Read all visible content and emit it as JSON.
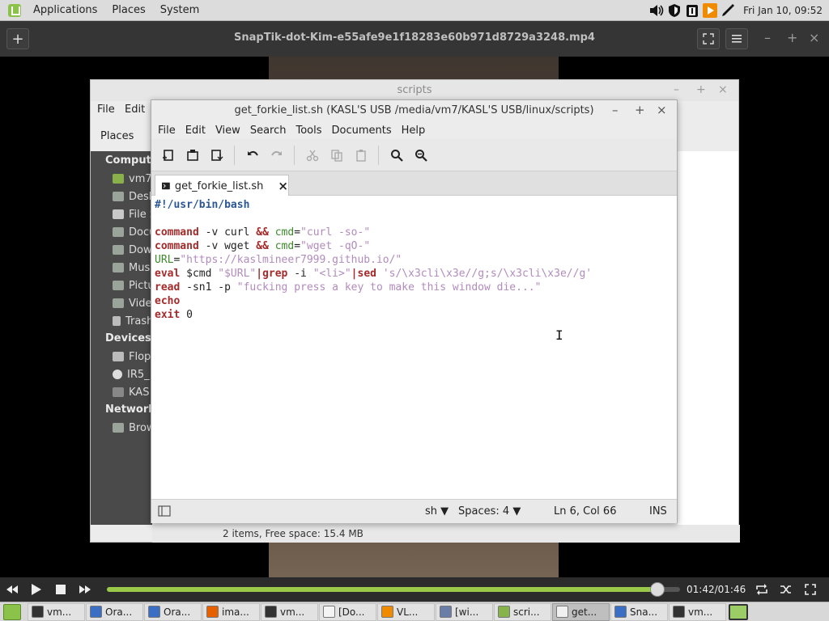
{
  "top_panel": {
    "menus": [
      "Applications",
      "Places",
      "System"
    ],
    "clock": "Fri Jan 10, 09:52"
  },
  "player": {
    "title": "SnapTik-dot-Kim-e55afe9e1f18283e60b971d8729a3248.mp4",
    "time": "01:42/01:46",
    "progress": 0.96,
    "accent_color": "#9ac94a"
  },
  "file_manager": {
    "title": "scripts",
    "menus": [
      "File",
      "Edit"
    ],
    "places_label": "Places",
    "computer_head": "Compute",
    "computer_items": [
      "vm7",
      "Desk",
      "File S",
      "Docu",
      "Dow",
      "Mus",
      "Pictu",
      "Vide",
      "Trash"
    ],
    "devices_head": "Devices",
    "device_items": [
      "Flop",
      "IR5_",
      "KAS"
    ],
    "network_head": "Network",
    "network_items": [
      "Brow"
    ],
    "status": "2 items, Free space: 15.4 MB"
  },
  "editor": {
    "title": "get_forkie_list.sh (KASL'S USB /media/vm7/KASL'S USB/linux/scripts)",
    "menus": [
      "File",
      "Edit",
      "View",
      "Search",
      "Tools",
      "Documents",
      "Help"
    ],
    "tab_label": "get_forkie_list.sh",
    "code": {
      "l1": "#!/usr/bin/bash",
      "l3_kw": "command",
      "l3_a": " -v curl ",
      "l3_op": "&&",
      "l3_sp": " ",
      "l3_var": "cmd",
      "l3_eq": "=",
      "l3_str": "\"curl -so-\"",
      "l4_kw": "command",
      "l4_a": " -v wget ",
      "l4_op": "&&",
      "l4_sp": " ",
      "l4_var": "cmd",
      "l4_eq": "=",
      "l4_str": "\"wget -qO-\"",
      "l5_var": "URL",
      "l5_eq": "=",
      "l5_str": "\"https://kaslmineer7999.github.io/\"",
      "l6_kw": "eval",
      "l6_a": " $cmd ",
      "l6_s1": "\"$URL\"",
      "l6_pipe1": "|grep",
      "l6_b": " -i ",
      "l6_s2": "\"<li>\"",
      "l6_pipe2": "|sed",
      "l6_c": " ",
      "l6_s3": "'s/\\x3cli\\x3e//g;s/\\x3cli\\x3e//g'",
      "l7_kw": "read",
      "l7_a": " -sn1 -p ",
      "l7_str": "\"fucking press a key to make this window die...\"",
      "l8_kw": "echo",
      "l9_kw": "exit",
      "l9_a": " 0"
    },
    "status": {
      "language": "sh",
      "spaces": "Spaces: 4",
      "position": "Ln 6, Col 66",
      "mode": "INS"
    }
  },
  "taskbar": {
    "items": [
      {
        "label": "vm...",
        "icon": "terminal-icon",
        "color": "#333333"
      },
      {
        "label": "Ora...",
        "icon": "virtualbox-icon",
        "color": "#3b6fc4"
      },
      {
        "label": "Ora...",
        "icon": "virtualbox-icon",
        "color": "#3b6fc4"
      },
      {
        "label": "ima...",
        "icon": "firefox-icon",
        "color": "#e66000"
      },
      {
        "label": "vm...",
        "icon": "terminal-icon",
        "color": "#333333"
      },
      {
        "label": "[Do...",
        "icon": "document-icon",
        "color": "#f4f4f4"
      },
      {
        "label": "VL...",
        "icon": "vlc-icon",
        "color": "#f08a00"
      },
      {
        "label": "[wi...",
        "icon": "wine-icon",
        "color": "#6a7ea8"
      },
      {
        "label": "scri...",
        "icon": "folder-icon",
        "color": "#86b34a"
      },
      {
        "label": "get...",
        "icon": "text-editor-icon",
        "color": "#f0f0f0"
      },
      {
        "label": "Sna...",
        "icon": "virtualbox-icon",
        "color": "#3b6fc4"
      },
      {
        "label": "vm...",
        "icon": "terminal-icon",
        "color": "#333333"
      }
    ]
  }
}
